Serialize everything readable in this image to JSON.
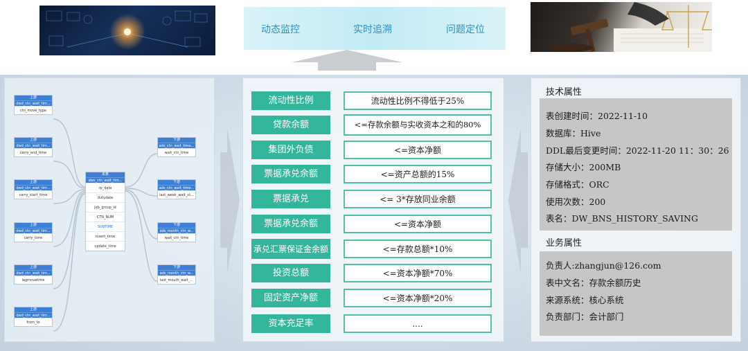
{
  "banner": {
    "items": [
      "动态监控",
      "实时追溯",
      "问题定位"
    ]
  },
  "lineage": {
    "upstream_tag": "上游",
    "downstream_tag": "下游",
    "center_tag": "本表",
    "upstream_nodes": [
      {
        "name": "dwd_ctn_wait_tim...",
        "field": "ctn_move_type"
      },
      {
        "name": "dwd_ctn_wait_tim...",
        "field": "carry_end_time"
      },
      {
        "name": "dwd_ctn_wait_tim...",
        "field": "carry_start_time"
      },
      {
        "name": "dwd_ctn_wait_tim...",
        "field": "carry_time"
      },
      {
        "name": "dwd_ctn_wait_tim...",
        "field": "lagmovetime"
      },
      {
        "name": "dwd_ctn_wait_tim...",
        "field": "from_to"
      }
    ],
    "center_node": {
      "name": "dws_ctn_wait_tim...",
      "fields": [
        "rp_date",
        "dutydate",
        "job_group_id",
        "CTN_NUM",
        "SUBTIME",
        "insert_time",
        "update_time"
      ]
    },
    "downstream_nodes": [
      {
        "name": "ads_ctn_wait_time...",
        "field": "wait_ctn_time"
      },
      {
        "name": "ads_ctn_wait_time...",
        "field": "last_week_wait_ct..."
      },
      {
        "name": "ads_month_ctn_w...",
        "field": "wait_ctn_time"
      },
      {
        "name": "ads_month_ctn_w...",
        "field": "last_mouth_wait_..."
      }
    ]
  },
  "rules": [
    {
      "name": "流动性比例",
      "condition": "流动性比例不得低于25%"
    },
    {
      "name": "贷款余额",
      "condition": "<=存款余额与实收资本之和的80%"
    },
    {
      "name": "集团外负债",
      "condition": "<=资本净额"
    },
    {
      "name": "票据承兑余额",
      "condition": "<=资产总额的15%"
    },
    {
      "name": "票据承兑",
      "condition": "<= 3*存放同业余额"
    },
    {
      "name": "票据承兑余额",
      "condition": "<=资本净额"
    },
    {
      "name": "承兑汇票保证金余额",
      "condition": "<=存款总额*10%"
    },
    {
      "name": "投资总额",
      "condition": "<=资本净额*70%"
    },
    {
      "name": "固定资产净额",
      "condition": "<=资本净额*20%"
    },
    {
      "name": "资本充足率",
      "condition": "...."
    }
  ],
  "tech_attrs": {
    "title": "技术属性",
    "lines": [
      "表创建时间：2022-11-10",
      "数据库：Hive",
      "DDL最后变更时间：2022-11-20 11：30：26",
      "存储大小：200MB",
      "存储格式：ORC",
      "使用次数：200",
      "表名：DW_BNS_HISTORY_SAVING"
    ]
  },
  "biz_attrs": {
    "title": "业务属性",
    "lines": [
      "负责人:zhangjun@126.com",
      "表中文名：存款余额历史",
      "来源系统：核心系统",
      "负责部门：会计部门"
    ]
  },
  "colors": {
    "rule_name_bg": "#33b69b",
    "rule_border": "#4fbfa6",
    "banner_text": "#2a90c4",
    "node_header": "#3e7fd6",
    "attr_box": "#c6c6c6"
  }
}
